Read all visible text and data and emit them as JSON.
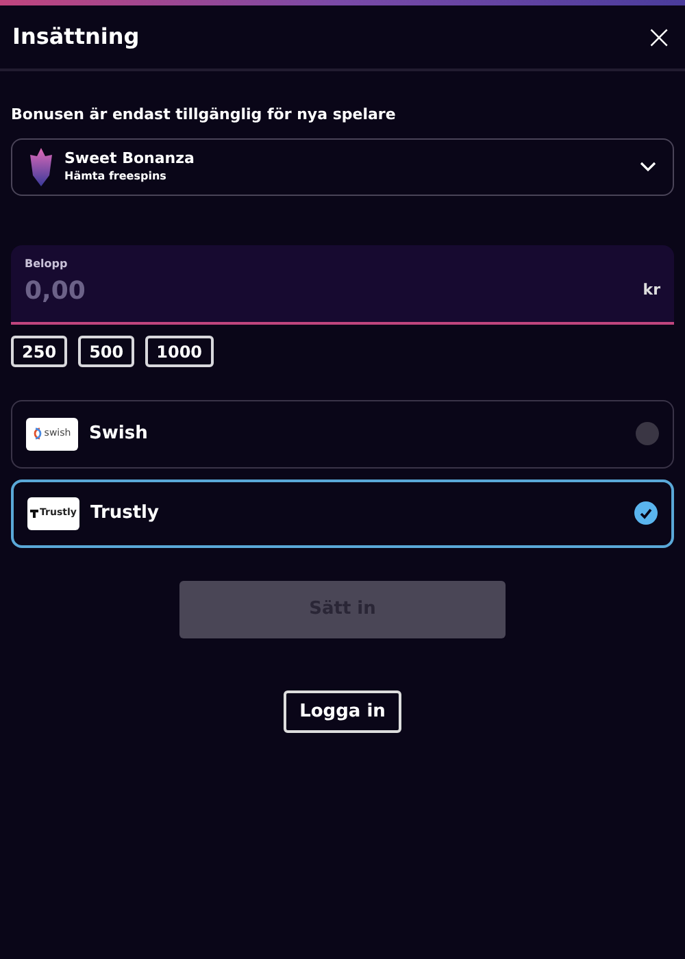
{
  "header": {
    "title": "Insättning",
    "close": "×"
  },
  "bonus": {
    "notice": "Bonusen är endast tillgänglig för nya spelare",
    "name": "Sweet Bonanza",
    "subtitle": "Hämta freespins",
    "expanded": false
  },
  "amount": {
    "label": "Belopp",
    "placeholder": "0,00",
    "currency": "kr"
  },
  "quick_amounts": [
    "250",
    "500",
    "1000"
  ],
  "methods": [
    {
      "kind": "swish",
      "logo_text": "swish",
      "name": "Swish",
      "selected": false
    },
    {
      "kind": "trustly",
      "logo_text": "Trustly",
      "name": "Trustly",
      "selected": true
    }
  ],
  "deposit_button": {
    "label": "Sätt in",
    "disabled": true
  },
  "login_button": {
    "label": "Logga in"
  }
}
